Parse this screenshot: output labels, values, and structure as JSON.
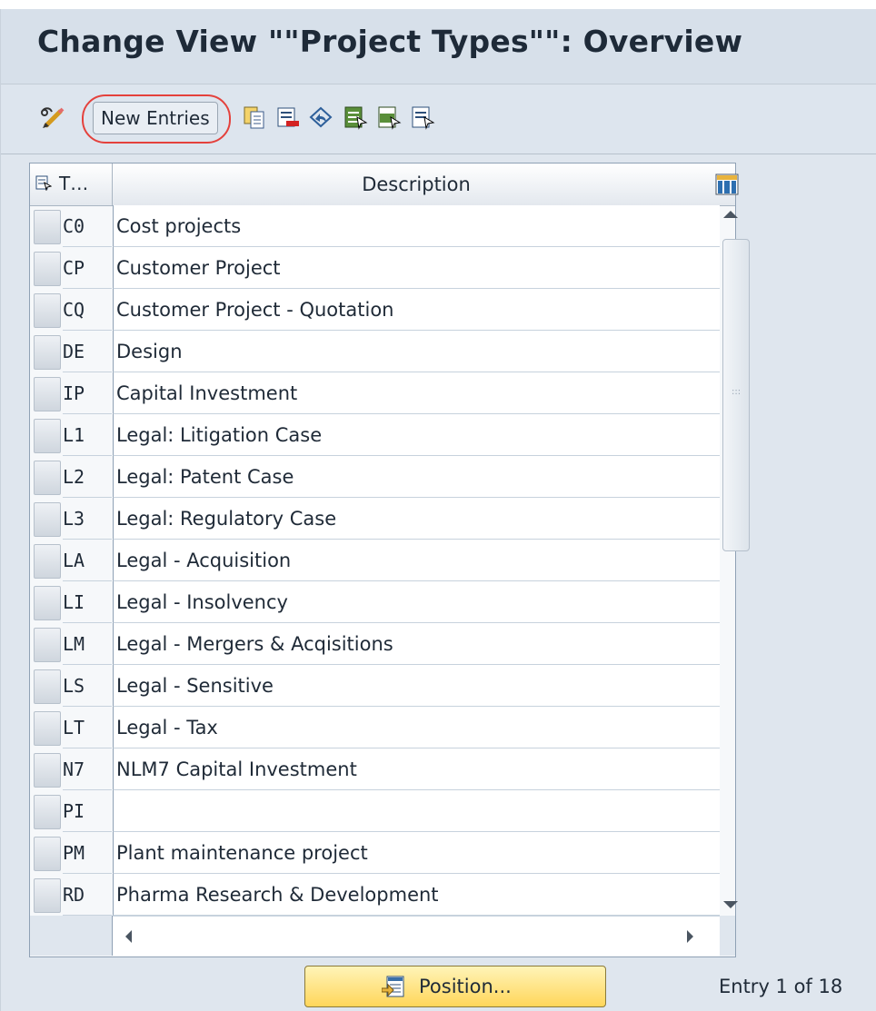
{
  "title": "Change View \"\"Project Types\"\": Overview",
  "toolbar": {
    "new_entries_label": "New Entries",
    "icons": [
      "display-change-icon",
      "copy-as-icon",
      "delete-icon",
      "undo-change-icon",
      "select-all-icon",
      "select-block-icon",
      "deselect-all-icon"
    ]
  },
  "table": {
    "col_type_header": "T…",
    "col_desc_header": "Description",
    "rows": [
      {
        "code": "C0",
        "desc": "Cost projects"
      },
      {
        "code": "CP",
        "desc": "Customer Project"
      },
      {
        "code": "CQ",
        "desc": "Customer Project - Quotation"
      },
      {
        "code": "DE",
        "desc": "Design"
      },
      {
        "code": "IP",
        "desc": "Capital Investment"
      },
      {
        "code": "L1",
        "desc": "Legal: Litigation Case"
      },
      {
        "code": "L2",
        "desc": "Legal: Patent Case"
      },
      {
        "code": "L3",
        "desc": "Legal: Regulatory Case"
      },
      {
        "code": "LA",
        "desc": "Legal - Acquisition"
      },
      {
        "code": "LI",
        "desc": "Legal - Insolvency"
      },
      {
        "code": "LM",
        "desc": "Legal - Mergers & Acqisitions"
      },
      {
        "code": "LS",
        "desc": "Legal - Sensitive"
      },
      {
        "code": "LT",
        "desc": "Legal - Tax"
      },
      {
        "code": "N7",
        "desc": "NLM7 Capital Investment"
      },
      {
        "code": "PI",
        "desc": ""
      },
      {
        "code": "PM",
        "desc": "Plant maintenance project"
      },
      {
        "code": "RD",
        "desc": "Pharma Research & Development"
      }
    ]
  },
  "footer": {
    "position_label": "Position...",
    "entry_text": "Entry 1 of 18"
  },
  "colors": {
    "highlight": "#e4413c",
    "position_button": "#ffd65a"
  }
}
